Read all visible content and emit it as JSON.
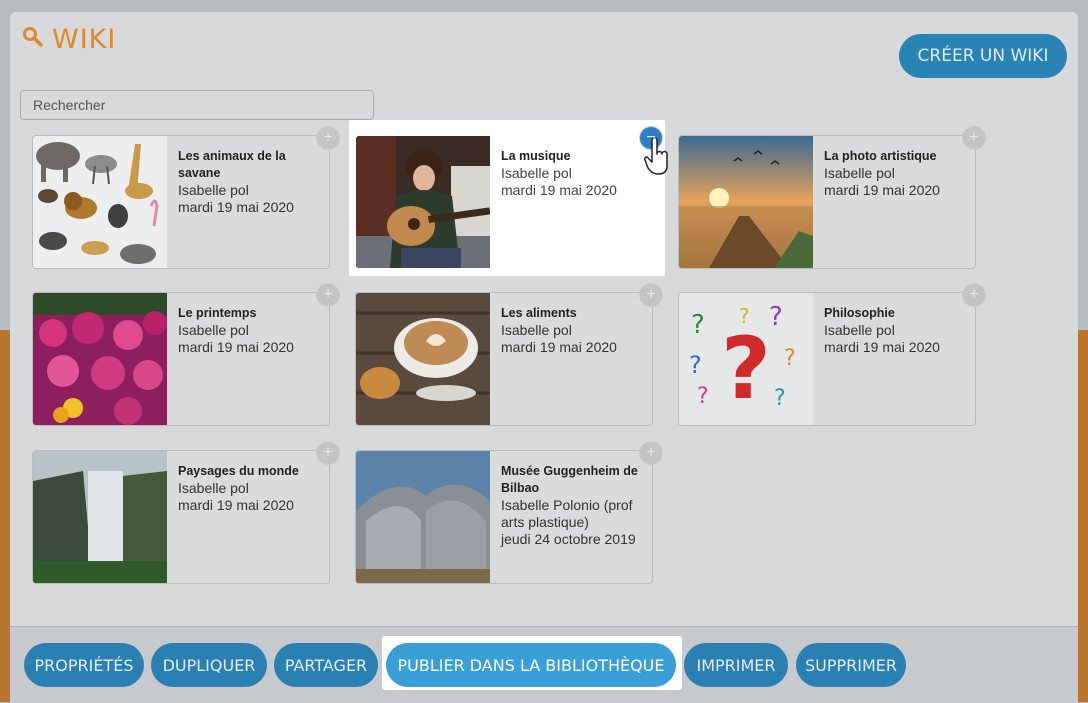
{
  "header": {
    "title": "WIKI",
    "create_label": "CRÉER UN WIKI"
  },
  "search": {
    "placeholder": "Rechercher"
  },
  "wikis": [
    {
      "name": "Les animaux de la savane",
      "author": "Isabelle pol",
      "date": "mardi 19 mai 2020",
      "thumb": "animals"
    },
    {
      "name": "La musique",
      "author": "Isabelle pol",
      "date": "mardi 19 mai 2020",
      "thumb": "guitar",
      "selected": true
    },
    {
      "name": "La photo artistique",
      "author": "Isabelle pol",
      "date": "mardi 19 mai 2020",
      "thumb": "sunset"
    },
    {
      "name": "Le printemps",
      "author": "Isabelle pol",
      "date": "mardi 19 mai 2020",
      "thumb": "flowers"
    },
    {
      "name": "Les aliments",
      "author": "Isabelle pol",
      "date": "mardi 19 mai 2020",
      "thumb": "coffee"
    },
    {
      "name": "Philosophie",
      "author": "Isabelle pol",
      "date": "mardi 19 mai 2020",
      "thumb": "questions"
    },
    {
      "name": "Paysages du monde",
      "author": "Isabelle pol",
      "date": "mardi 19 mai 2020",
      "thumb": "waterfall"
    },
    {
      "name": "Musée Guggenheim de Bilbao",
      "author": "Isabelle Polonio (prof arts plastique)",
      "date": "jeudi 24 octobre 2019",
      "thumb": "museum"
    }
  ],
  "add_symbol": "+",
  "remove_symbol": "−",
  "actions": {
    "properties": "PROPRIÉTÉS",
    "duplicate": "DUPLIQUER",
    "share": "PARTAGER",
    "publish": "PUBLIER DANS LA BIBLIOTHÈQUE",
    "print": "IMPRIMER",
    "delete": "SUPPRIMER"
  },
  "colors": {
    "accent": "#2a80b3",
    "title": "#e3872a",
    "publish": "#3a9fd9"
  }
}
